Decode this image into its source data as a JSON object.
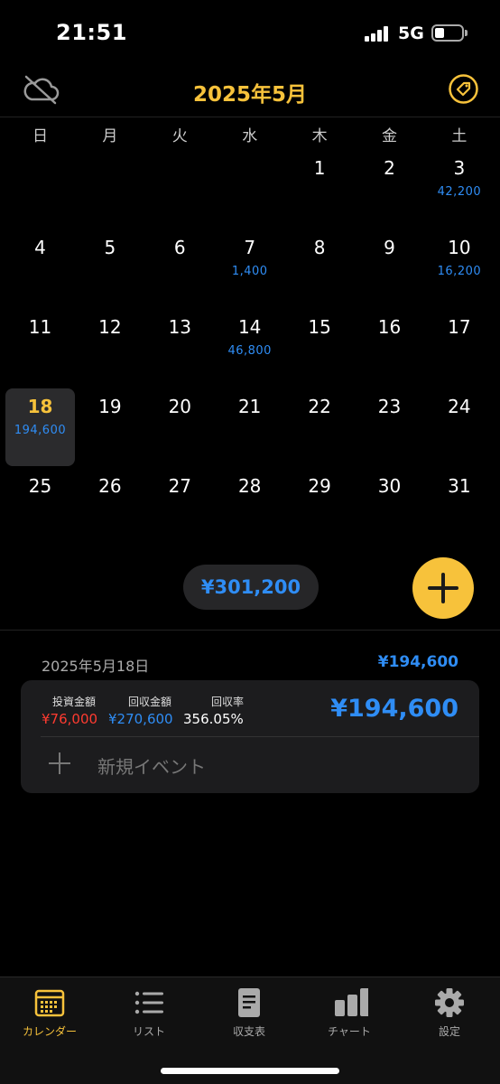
{
  "status_bar": {
    "time": "21:51",
    "network": "5G",
    "battery_level": 0.35
  },
  "header": {
    "title": "2025年5月",
    "left_icon": "cloud-off-icon",
    "right_icon": "tag-icon"
  },
  "weekdays": [
    "日",
    "月",
    "火",
    "水",
    "木",
    "金",
    "土"
  ],
  "calendar": {
    "days": [
      {
        "day": "1",
        "amount": ""
      },
      {
        "day": "2",
        "amount": ""
      },
      {
        "day": "3",
        "amount": "42,200"
      },
      {
        "day": "4",
        "amount": ""
      },
      {
        "day": "5",
        "amount": ""
      },
      {
        "day": "6",
        "amount": ""
      },
      {
        "day": "7",
        "amount": "1,400"
      },
      {
        "day": "8",
        "amount": ""
      },
      {
        "day": "9",
        "amount": ""
      },
      {
        "day": "10",
        "amount": "16,200"
      },
      {
        "day": "11",
        "amount": ""
      },
      {
        "day": "12",
        "amount": ""
      },
      {
        "day": "13",
        "amount": ""
      },
      {
        "day": "14",
        "amount": "46,800"
      },
      {
        "day": "15",
        "amount": ""
      },
      {
        "day": "16",
        "amount": ""
      },
      {
        "day": "17",
        "amount": ""
      },
      {
        "day": "18",
        "amount": "194,600",
        "selected": true
      },
      {
        "day": "19",
        "amount": ""
      },
      {
        "day": "20",
        "amount": ""
      },
      {
        "day": "21",
        "amount": ""
      },
      {
        "day": "22",
        "amount": ""
      },
      {
        "day": "23",
        "amount": ""
      },
      {
        "day": "24",
        "amount": ""
      },
      {
        "day": "25",
        "amount": ""
      },
      {
        "day": "26",
        "amount": ""
      },
      {
        "day": "27",
        "amount": ""
      },
      {
        "day": "28",
        "amount": ""
      },
      {
        "day": "29",
        "amount": ""
      },
      {
        "day": "30",
        "amount": ""
      },
      {
        "day": "31",
        "amount": ""
      }
    ],
    "first_weekday_index": 4
  },
  "summary": {
    "month_total": "¥301,200"
  },
  "detail": {
    "date": "2025年5月18日",
    "total": "¥194,600",
    "card": {
      "invest_label": "投資金額",
      "invest_value": "¥76,000",
      "return_label": "回収金額",
      "return_value": "¥270,600",
      "rate_label": "回収率",
      "rate_value": "356.05%",
      "amount": "¥194,600",
      "new_event_label": "新規イベント"
    }
  },
  "colors": {
    "accent": "#f7c23b",
    "blue": "#2f8df5",
    "red": "#ff3b30"
  },
  "tabs": [
    {
      "label": "カレンダー",
      "icon": "calendar-icon",
      "active": true
    },
    {
      "label": "リスト",
      "icon": "list-icon"
    },
    {
      "label": "収支表",
      "icon": "document-icon"
    },
    {
      "label": "チャート",
      "icon": "bar-chart-icon"
    },
    {
      "label": "設定",
      "icon": "gear-icon"
    }
  ]
}
